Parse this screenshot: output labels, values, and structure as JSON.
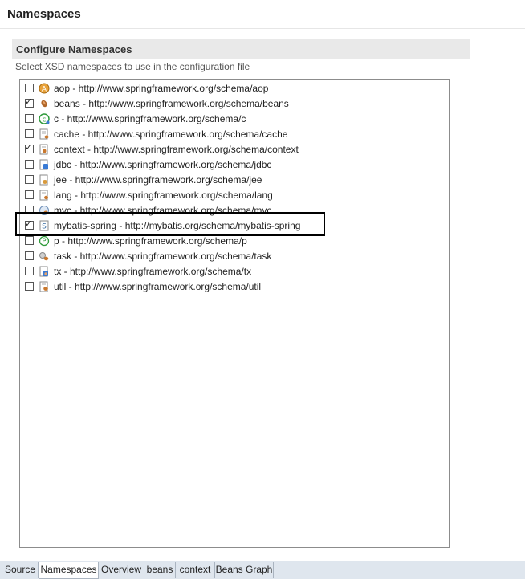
{
  "page": {
    "title": "Namespaces"
  },
  "section": {
    "title": "Configure Namespaces",
    "description": "Select XSD namespaces to use in the configuration file"
  },
  "namespaces": [
    {
      "label": "aop - http://www.springframework.org/schema/aop",
      "checked": false,
      "icon": "aop-icon"
    },
    {
      "label": "beans - http://www.springframework.org/schema/beans",
      "checked": true,
      "icon": "beans-icon"
    },
    {
      "label": "c - http://www.springframework.org/schema/c",
      "checked": false,
      "icon": "c-icon"
    },
    {
      "label": "cache - http://www.springframework.org/schema/cache",
      "checked": false,
      "icon": "cache-icon"
    },
    {
      "label": "context - http://www.springframework.org/schema/context",
      "checked": true,
      "icon": "context-icon"
    },
    {
      "label": "jdbc - http://www.springframework.org/schema/jdbc",
      "checked": false,
      "icon": "jdbc-icon"
    },
    {
      "label": "jee - http://www.springframework.org/schema/jee",
      "checked": false,
      "icon": "jee-icon"
    },
    {
      "label": "lang - http://www.springframework.org/schema/lang",
      "checked": false,
      "icon": "lang-icon"
    },
    {
      "label": "mvc - http://www.springframework.org/schema/mvc",
      "checked": false,
      "icon": "mvc-icon"
    },
    {
      "label": "mybatis-spring - http://mybatis.org/schema/mybatis-spring",
      "checked": true,
      "icon": "mybatis-spring-icon"
    },
    {
      "label": "p - http://www.springframework.org/schema/p",
      "checked": false,
      "icon": "p-icon"
    },
    {
      "label": "task - http://www.springframework.org/schema/task",
      "checked": false,
      "icon": "task-icon"
    },
    {
      "label": "tx - http://www.springframework.org/schema/tx",
      "checked": false,
      "icon": "tx-icon"
    },
    {
      "label": "util - http://www.springframework.org/schema/util",
      "checked": false,
      "icon": "util-icon"
    }
  ],
  "tabs": [
    {
      "label": "Source",
      "active": false
    },
    {
      "label": "Namespaces",
      "active": true
    },
    {
      "label": "Overview",
      "active": false
    },
    {
      "label": "beans",
      "active": false
    },
    {
      "label": "context",
      "active": false
    },
    {
      "label": "Beans Graph",
      "active": false
    }
  ],
  "colors": {
    "tab_bar": "#dfe6ee",
    "section_header": "#e9e9e9",
    "highlight_border": "#000000"
  }
}
